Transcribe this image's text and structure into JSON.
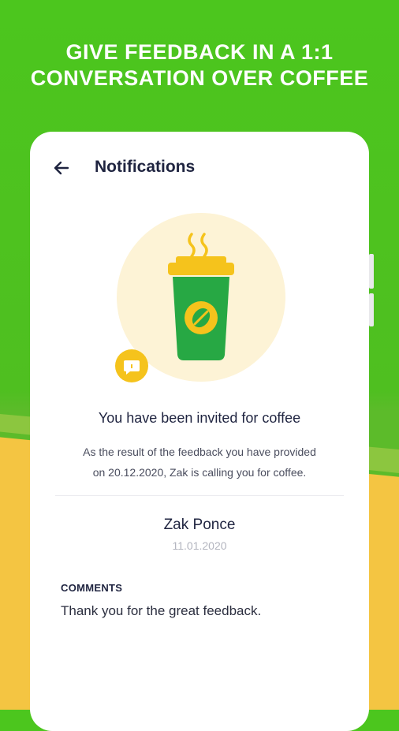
{
  "headline": {
    "line1": "GIVE FEEDBACK IN A 1:1",
    "line2": "CONVERSATION OVER COFFEE"
  },
  "topbar": {
    "title": "Notifications",
    "back_icon": "arrow-left-icon"
  },
  "illustration": {
    "cup_icon": "coffee-cup-icon",
    "badge_icon": "chat-bubble-icon"
  },
  "notification": {
    "heading": "You have been invited for coffee",
    "description_line1": "As the result of the feedback you have provided",
    "description_line2": "on 20.12.2020, Zak is calling you for coffee.",
    "person_name": "Zak Ponce",
    "date": "11.01.2020"
  },
  "comments": {
    "label": "COMMENTS",
    "text": "Thank you for the great feedback."
  },
  "colors": {
    "brand_green": "#4cc61e",
    "cup_green": "#27a844",
    "accent_yellow": "#f5c31c",
    "cream": "#fdf3d6",
    "text_dark": "#1f2440"
  }
}
